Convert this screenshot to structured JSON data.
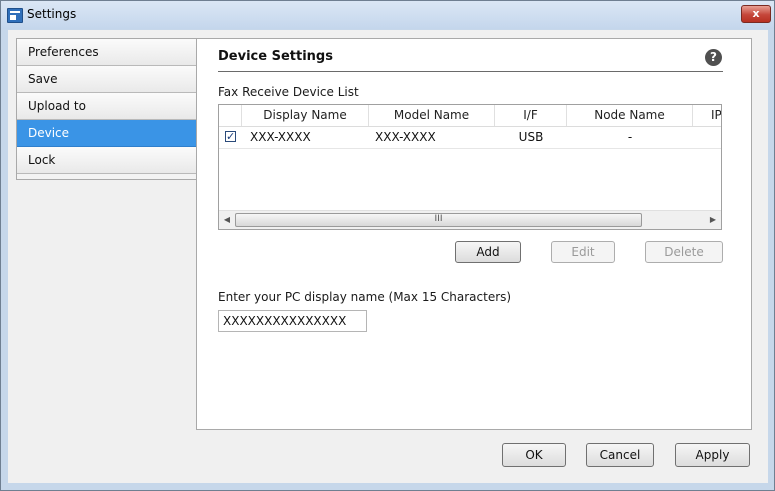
{
  "window": {
    "title": "Settings",
    "close_label": "x"
  },
  "sidebar": {
    "items": [
      {
        "label": "Preferences",
        "selected": false
      },
      {
        "label": "Save",
        "selected": false
      },
      {
        "label": "Upload to",
        "selected": false
      },
      {
        "label": "Device",
        "selected": true
      },
      {
        "label": "Lock",
        "selected": false
      }
    ]
  },
  "panel": {
    "title": "Device Settings",
    "help_icon": "?",
    "list_label": "Fax Receive Device List",
    "columns": [
      "Display Name",
      "Model Name",
      "I/F",
      "Node Name",
      "IP"
    ],
    "rows": [
      {
        "checked": true,
        "check_glyph": "✓",
        "display_name": "XXX-XXXX",
        "model_name": "XXX-XXXX",
        "interface": "USB",
        "node_name": "-",
        "ip": ""
      }
    ],
    "scroll_grip": "III",
    "scroll_left": "◀",
    "scroll_right": "▶",
    "buttons": {
      "add": "Add",
      "edit": "Edit",
      "delete": "Delete"
    },
    "name_label": "Enter your PC display name (Max 15 Characters)",
    "name_value": "XXXXXXXXXXXXXXX"
  },
  "footer": {
    "ok": "OK",
    "cancel": "Cancel",
    "apply": "Apply"
  },
  "colors": {
    "selection": "#3a94e6",
    "frame": "#c6d7ea"
  }
}
